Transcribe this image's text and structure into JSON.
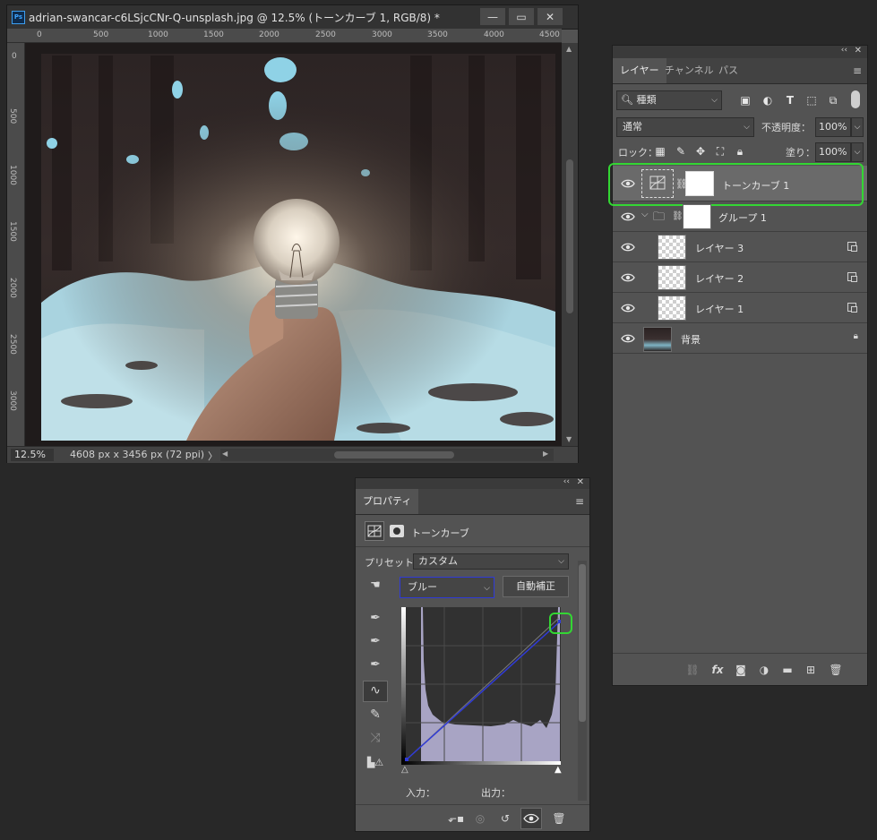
{
  "document": {
    "title": "adrian-swancar-c6LSjcCNr-Q-unsplash.jpg @ 12.5% (トーンカーブ 1, RGB/8) *",
    "app_icon": "Ps",
    "ruler_top_ticks": [
      "0",
      "500",
      "1000",
      "1500",
      "2000",
      "2500",
      "3000",
      "3500",
      "4000",
      "4500"
    ],
    "ruler_left_ticks": [
      "0",
      "500",
      "1000",
      "1500",
      "2000",
      "2500",
      "3000"
    ],
    "zoom": "12.5%",
    "doc_info": "4608 px x 3456 px (72 ppi)",
    "status_arrow": "〉",
    "window_buttons": [
      "minimize-icon",
      "maximize-icon",
      "close-icon"
    ]
  },
  "layers_panel": {
    "tabs": [
      "レイヤー",
      "チャンネル",
      "パス"
    ],
    "filter_kind": "種類",
    "blend_mode": "通常",
    "opacity_label": "不透明度：",
    "opacity_value": "100%",
    "lock_label": "ロック：",
    "fill_label": "塗り：",
    "fill_value": "100%",
    "layers": [
      {
        "name": "トーンカーブ 1",
        "type": "adjustment",
        "selected": true
      },
      {
        "name": "グループ 1",
        "type": "group"
      },
      {
        "name": "レイヤー 3",
        "type": "smart-object"
      },
      {
        "name": "レイヤー 2",
        "type": "smart-object"
      },
      {
        "name": "レイヤー 1",
        "type": "smart-object"
      },
      {
        "name": "背景",
        "type": "background",
        "locked": true
      }
    ],
    "highlight_color": "#33d633"
  },
  "properties_panel": {
    "tab": "プロパティ",
    "adjustment_name": "トーンカーブ",
    "preset_label": "プリセット：",
    "preset_value": "カスタム",
    "channel": "ブルー",
    "auto_button": "自動補正",
    "input_label": "入力：",
    "output_label": "出力：",
    "channel_color": "#2f3ad8",
    "highlight_color": "#33d633"
  }
}
